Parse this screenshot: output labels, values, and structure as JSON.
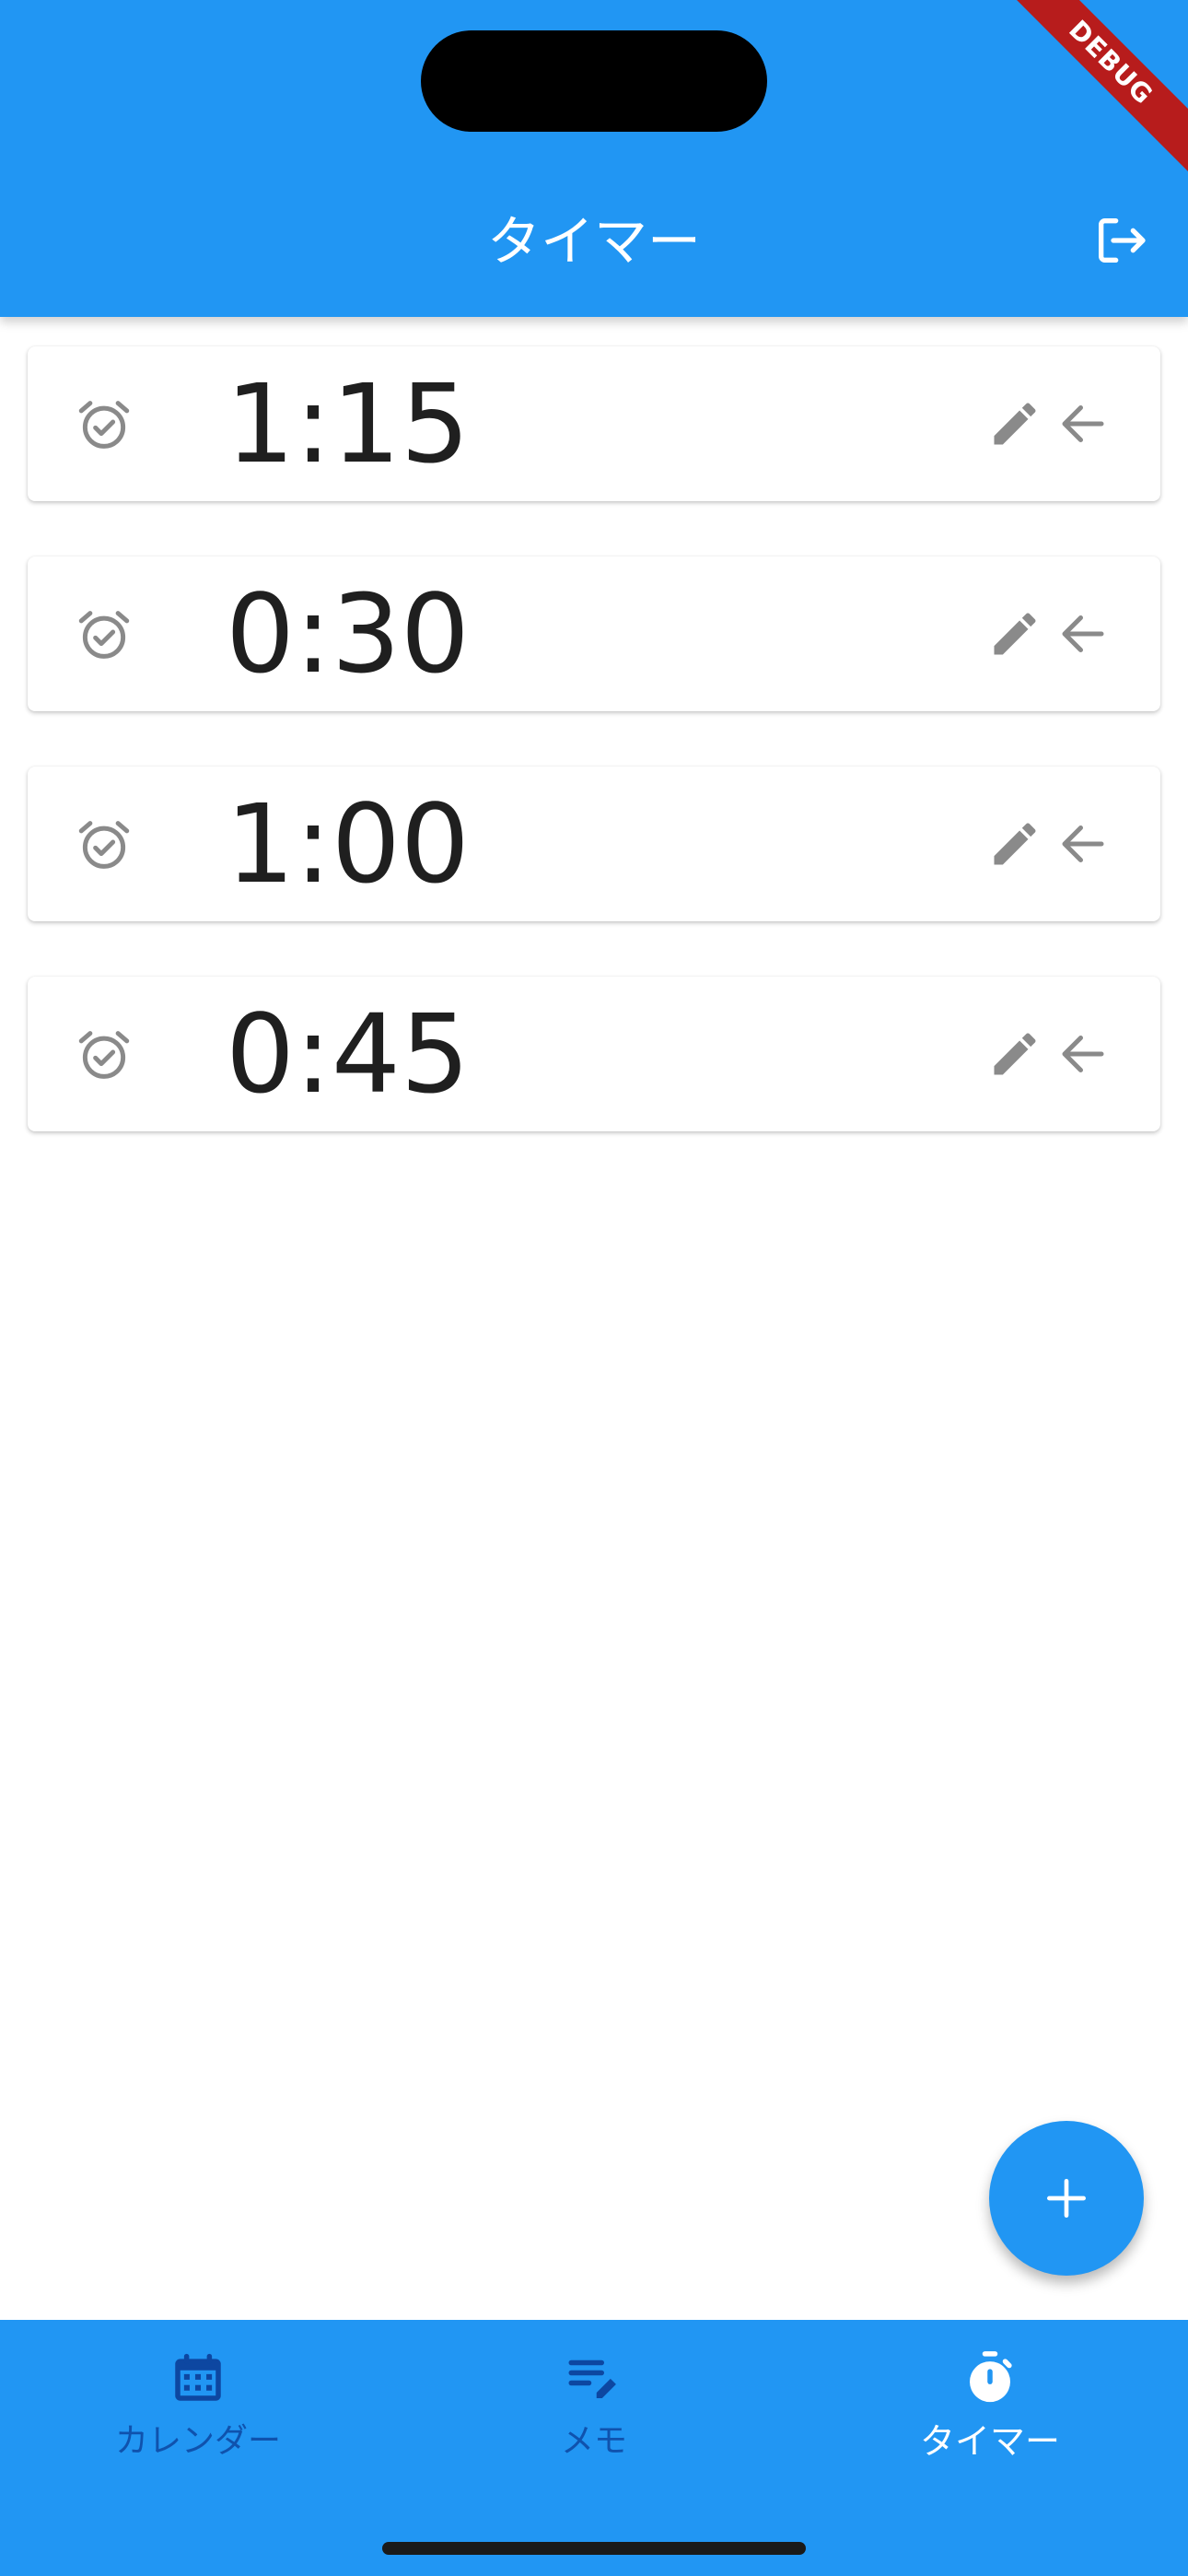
{
  "app_bar": {
    "title": "タイマー",
    "logout_icon": "logout-icon",
    "debug_banner": "DEBUG",
    "background_color": "#2196F3"
  },
  "timers": [
    {
      "time": "1:15"
    },
    {
      "time": "0:30"
    },
    {
      "time": "1:00"
    },
    {
      "time": "0:45"
    }
  ],
  "timer_icons": {
    "leading": "alarm-on-icon",
    "edit": "edit-icon",
    "action": "arrow-back-icon",
    "icon_color": "#8a8a8a"
  },
  "fab": {
    "icon": "add-icon"
  },
  "bottom_nav": {
    "items": [
      {
        "label": "カレンダー",
        "icon": "calendar-icon",
        "active": false
      },
      {
        "label": "メモ",
        "icon": "edit-note-icon",
        "active": false
      },
      {
        "label": "タイマー",
        "icon": "timer-icon",
        "active": true
      }
    ],
    "active_color": "#ffffff",
    "inactive_color": "#0D47A1"
  }
}
